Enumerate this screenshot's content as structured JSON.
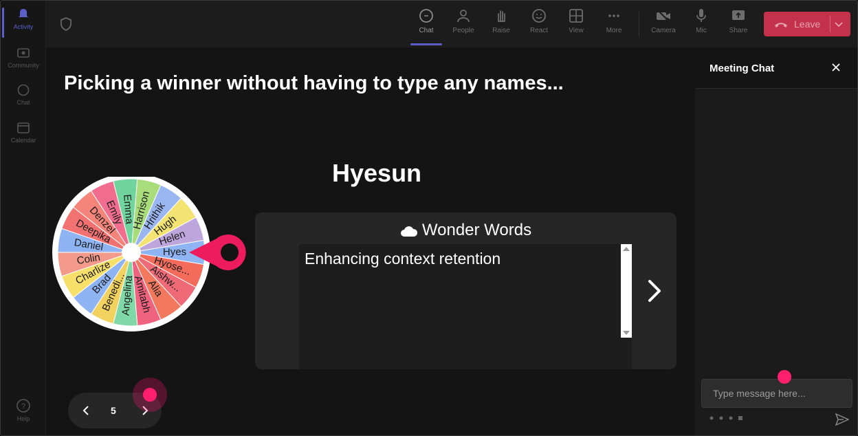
{
  "rail": {
    "items": [
      {
        "label": "Activity"
      },
      {
        "label": "Community"
      },
      {
        "label": "Chat"
      },
      {
        "label": "Calendar"
      }
    ],
    "help_label": "Help"
  },
  "topbar": {
    "buttons": [
      {
        "label": "Chat",
        "icon": "chat-icon"
      },
      {
        "label": "People",
        "icon": "people-icon"
      },
      {
        "label": "Raise",
        "icon": "raise-hand-icon"
      },
      {
        "label": "React",
        "icon": "react-icon"
      },
      {
        "label": "View",
        "icon": "view-icon"
      },
      {
        "label": "More",
        "icon": "more-icon"
      },
      {
        "label": "Camera",
        "icon": "camera-off-icon"
      },
      {
        "label": "Mic",
        "icon": "mic-icon"
      },
      {
        "label": "Share",
        "icon": "share-icon"
      }
    ],
    "leave_label": "Leave",
    "accent": "#5b5fc7",
    "leave_color": "#c4314b"
  },
  "slide": {
    "title": "Picking a winner without having to type any names...",
    "winner": "Hyesun",
    "wheel": {
      "names": [
        "Hyes",
        "Hyose...",
        "Aishw...",
        "Alia",
        "Amitabh",
        "Angelina",
        "Benedi...",
        "Brad",
        "Charlize",
        "Colin",
        "Daniel",
        "Deepika",
        "Denzel",
        "Emily",
        "Emma",
        "Harrison",
        "Hrithik",
        "Hugh",
        "Helen"
      ],
      "colors": [
        "#8fb4f4",
        "#f26b5b",
        "#ee6a77",
        "#f2795e",
        "#f0637f",
        "#7fd8a6",
        "#f2d25e",
        "#8fb4f4",
        "#f6e06a",
        "#f49a8a",
        "#8fb4f4",
        "#f27272",
        "#f5857a",
        "#f06d8f",
        "#70d49c",
        "#a9dc7a",
        "#9ab6f0",
        "#f3e373",
        "#bda6dc"
      ]
    },
    "card": {
      "title": "Wonder Words",
      "text": "Enhancing context retention"
    },
    "pager": {
      "page": "5"
    }
  },
  "chat": {
    "title": "Meeting Chat",
    "placeholder": "Type message here..."
  }
}
